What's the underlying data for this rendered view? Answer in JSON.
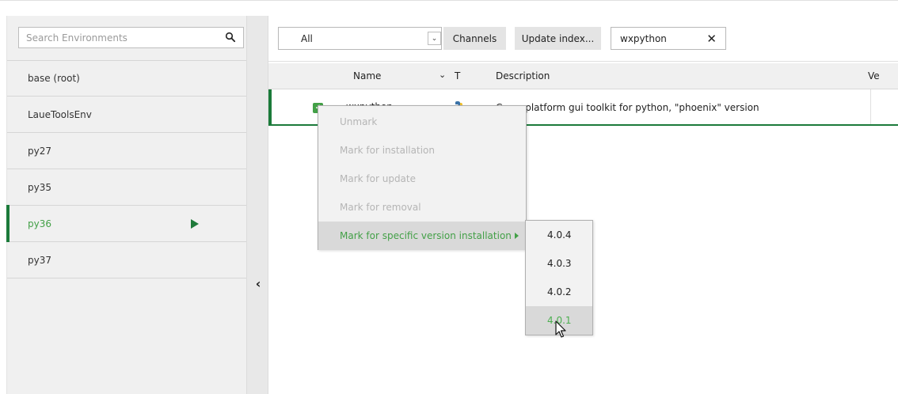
{
  "sidebar": {
    "search_placeholder": "Search Environments",
    "environments": [
      {
        "label": "base (root)"
      },
      {
        "label": "LaueToolsEnv"
      },
      {
        "label": "py27"
      },
      {
        "label": "py35"
      },
      {
        "label": "py36",
        "active": true
      },
      {
        "label": "py37"
      }
    ]
  },
  "toolbar": {
    "filter_value": "All",
    "channels_label": "Channels",
    "update_index_label": "Update index...",
    "package_search_value": "wxpython"
  },
  "table": {
    "columns": {
      "name": "Name",
      "type": "T",
      "description": "Description",
      "version": "Ve"
    },
    "rows": [
      {
        "name": "wxpython",
        "description": "Cross-platform gui toolkit for python, \"phoenix\" version",
        "marked": true
      }
    ]
  },
  "context_menu": {
    "items": [
      {
        "label": "Unmark",
        "enabled": false
      },
      {
        "label": "Mark for installation",
        "enabled": false
      },
      {
        "label": "Mark for update",
        "enabled": false
      },
      {
        "label": "Mark for removal",
        "enabled": false
      },
      {
        "label": "Mark for specific version installation",
        "enabled": true,
        "highlighted": true
      }
    ],
    "versions": [
      "4.0.4",
      "4.0.3",
      "4.0.2",
      "4.0.1"
    ],
    "hovered_version": "4.0.1"
  },
  "colors": {
    "accent_green": "#43a047",
    "dark_green": "#1b7a3a",
    "disabled_text": "#b5b5b5"
  },
  "icons": {
    "search": "search-icon",
    "active_env": "play-icon",
    "collapse": "chevron-left-icon",
    "dropdown": "chevron-down-icon",
    "clear": "close-icon",
    "package_type": "python-icon",
    "submenu": "chevron-right-icon",
    "cursor": "mouse-pointer-icon"
  }
}
